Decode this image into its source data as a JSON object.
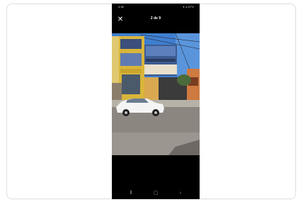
{
  "status_bar": {
    "time": "4:38",
    "icons": "▾ ⊿ 67%"
  },
  "viewer": {
    "counter": "2 de 9",
    "close_symbol": "✕"
  },
  "photo": {
    "icon": "street-photo"
  },
  "nav_bar": {
    "recents_symbol": "⦀",
    "home_symbol": "▢",
    "back_symbol": "‹"
  }
}
